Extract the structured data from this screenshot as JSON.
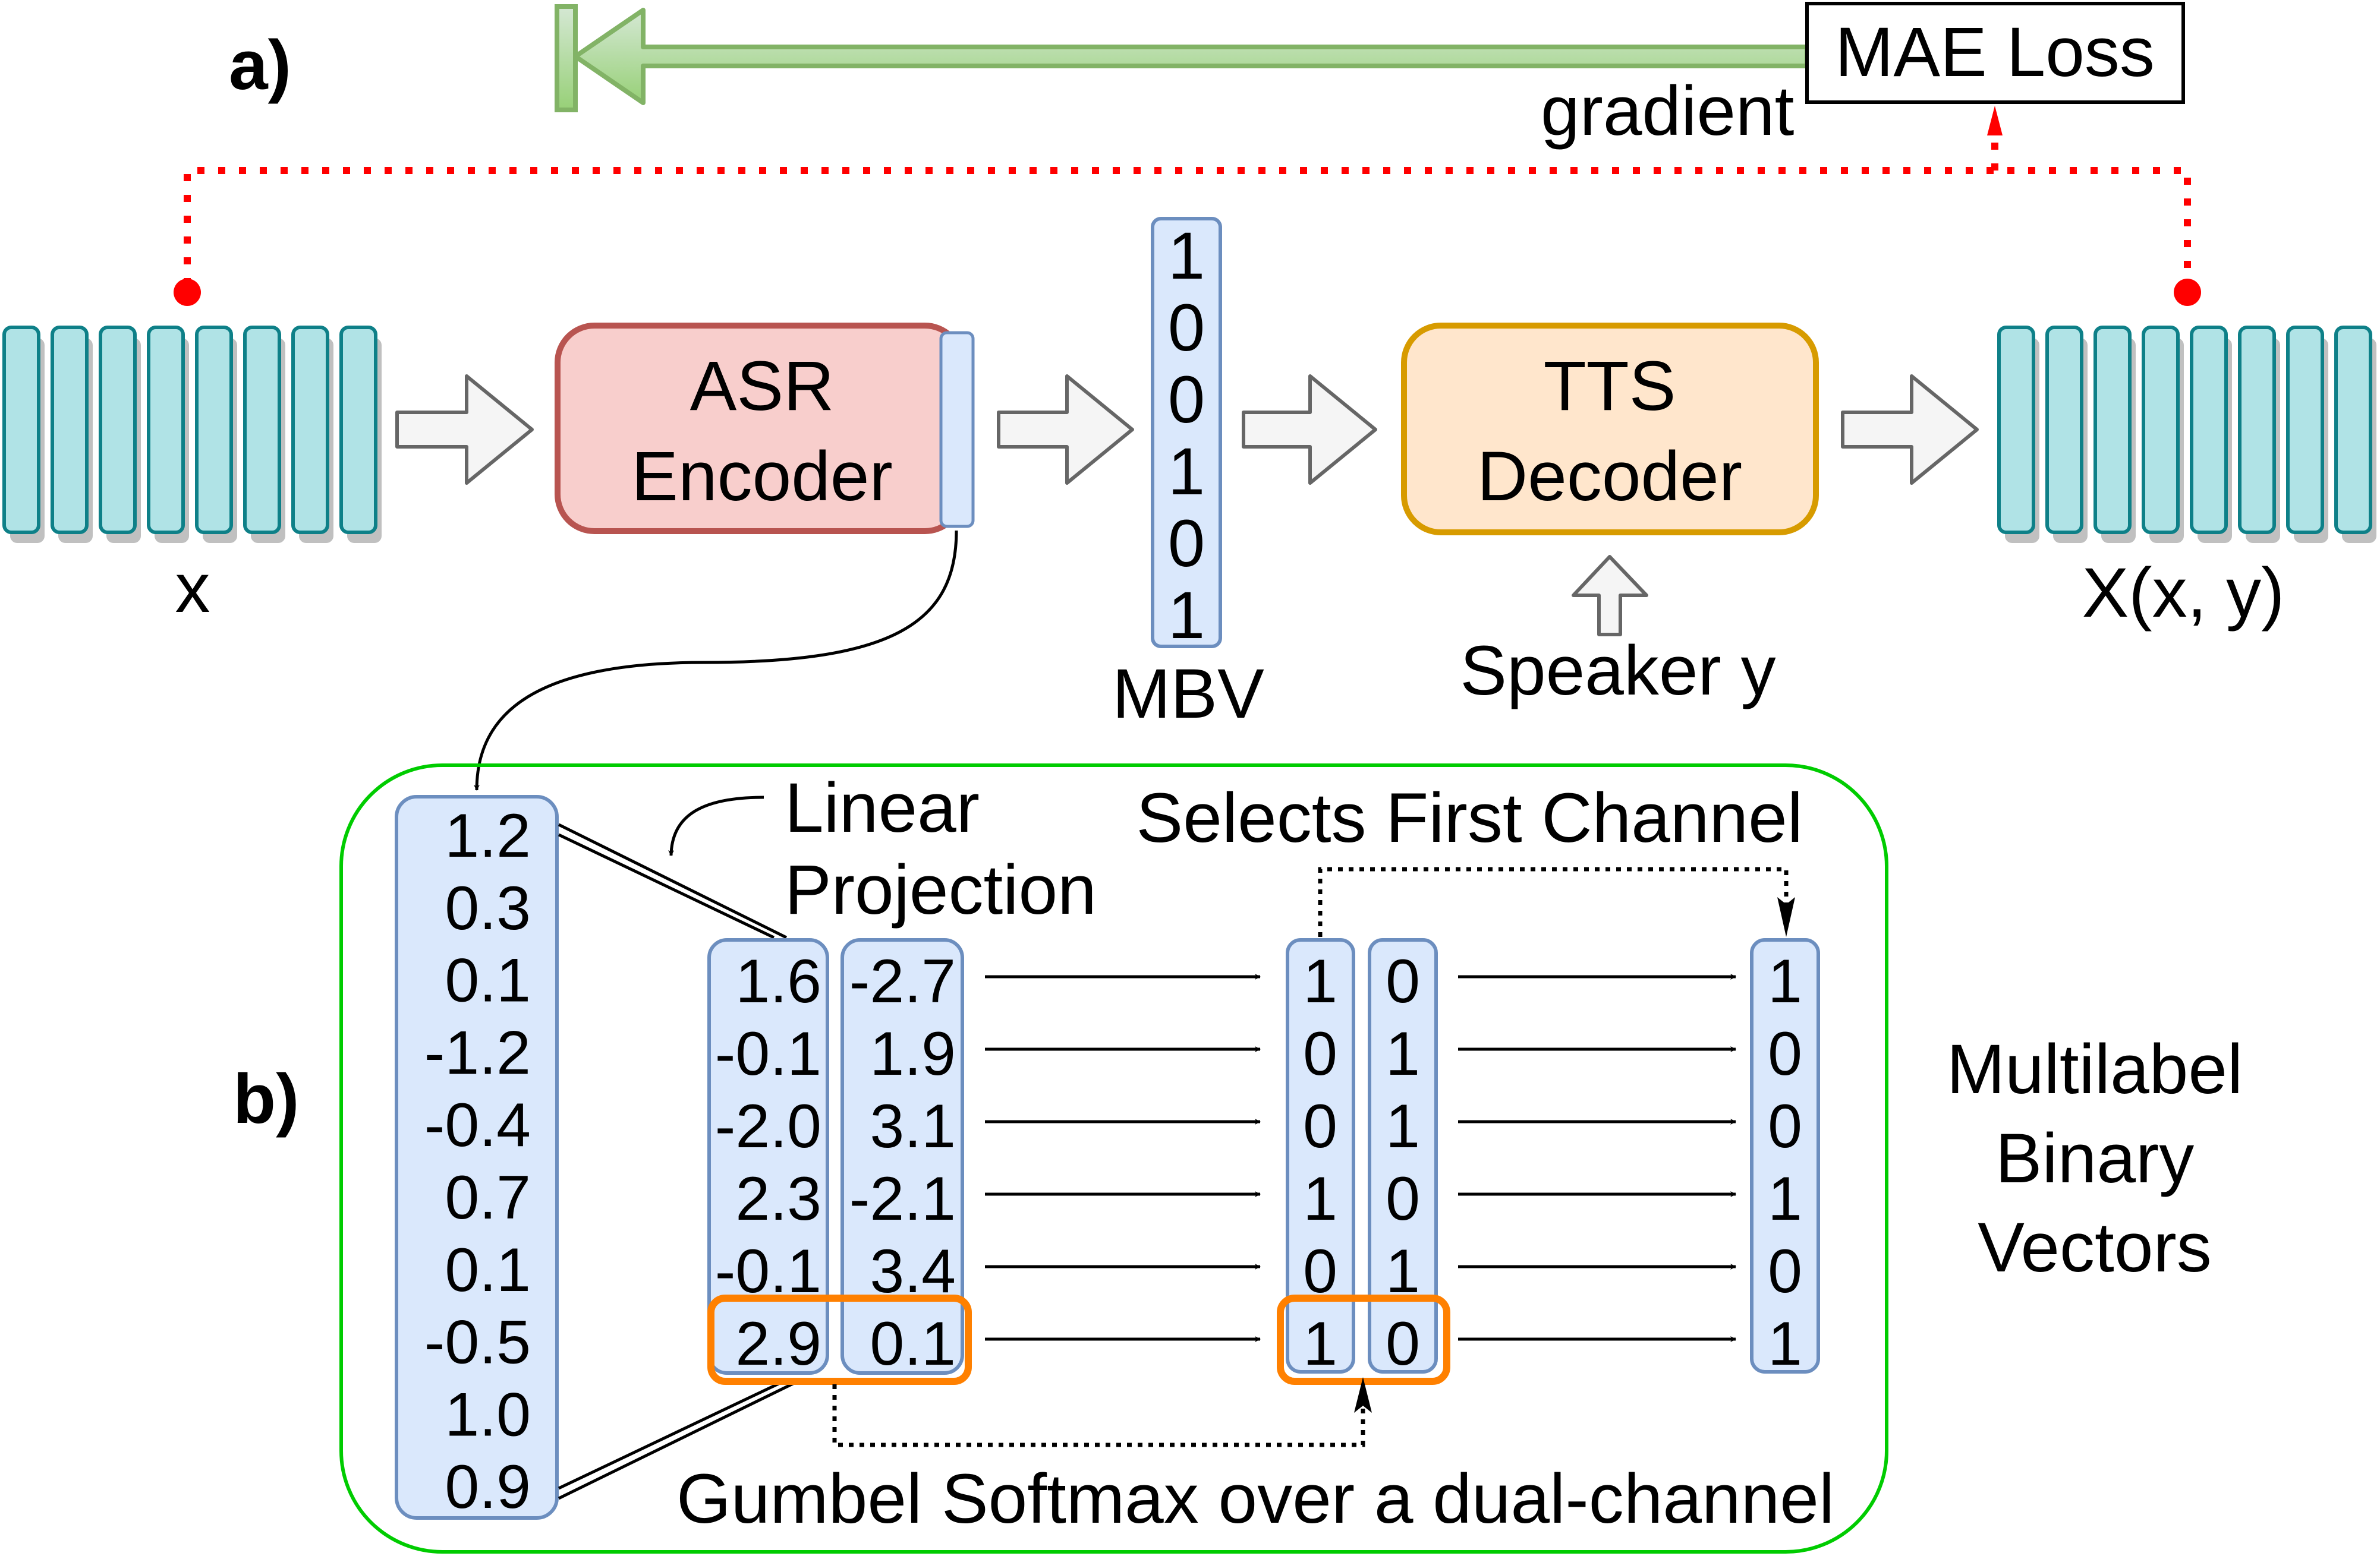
{
  "panel_a": {
    "label": "a)",
    "input_label": "x",
    "output_label": "X(x, y)",
    "frames_count": 8,
    "asr": {
      "line1": "ASR",
      "line2": "Encoder"
    },
    "tts": {
      "line1": "TTS",
      "line2": "Decoder"
    },
    "mbv": {
      "label": "MBV",
      "bits": [
        "1",
        "0",
        "0",
        "1",
        "0",
        "1"
      ]
    },
    "speaker_label": "Speaker y",
    "loss_label": "MAE Loss",
    "gradient_label": "gradient"
  },
  "panel_b": {
    "label": "b)",
    "encoder_values": [
      "1.2",
      "0.3",
      "0.1",
      "-1.2",
      "-0.4",
      "0.7",
      "0.1",
      "-0.5",
      "1.0",
      "0.9"
    ],
    "linear_projection_label": [
      "Linear",
      "Projection"
    ],
    "projection": {
      "channel1": [
        "1.6",
        "-0.1",
        "-2.0",
        "2.3",
        "-0.1",
        "2.9"
      ],
      "channel2": [
        "-2.7",
        "1.9",
        "3.1",
        "-2.1",
        "3.4",
        "0.1"
      ]
    },
    "gumbel": {
      "channel1": [
        "1",
        "0",
        "0",
        "1",
        "0",
        "1"
      ],
      "channel2": [
        "0",
        "1",
        "1",
        "0",
        "1",
        "0"
      ]
    },
    "output_vector": [
      "1",
      "0",
      "0",
      "1",
      "0",
      "1"
    ],
    "selects_label": "Selects First Channel",
    "gumbel_label": "Gumbel Softmax over a dual-channel",
    "result_label": [
      "Multilabel",
      "Binary",
      "Vectors"
    ]
  },
  "colors": {
    "frame_fill": "#b0e3e6",
    "frame_stroke": "#0e8088",
    "asr_fill": "#f8cecc",
    "asr_stroke": "#b85450",
    "tts_fill": "#ffe6cc",
    "tts_stroke": "#d79b00",
    "vector_fill": "#dae8fc",
    "vector_stroke": "#6c8ebf",
    "gradient_fill": "#b9dca0",
    "gradient_stroke": "#82b366",
    "loss_path": "#ff0000",
    "highlight": "#ff8000",
    "panel_frame": "#00cc00"
  }
}
